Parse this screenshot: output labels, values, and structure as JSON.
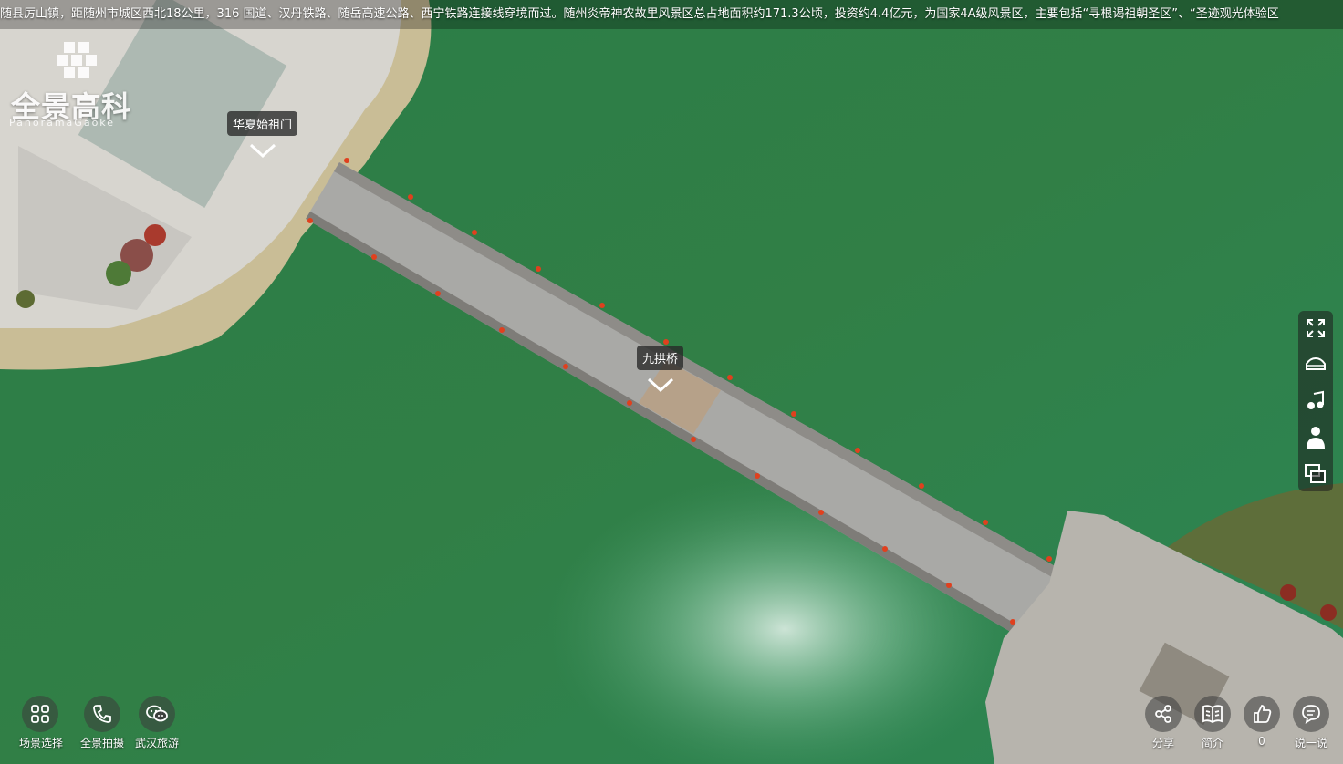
{
  "marquee": {
    "text": "随县厉山镇，距随州市城区西北18公里，316 国道、汉丹铁路、随岳高速公路、西宁铁路连接线穿境而过。随州炎帝神农故里风景区总占地面积约171.3公顷，投资约4.4亿元，为国家4A级风景区，主要包括“寻根谒祖朝圣区”、“圣迹观光体验区"
  },
  "logo": {
    "title": "全景高科",
    "subtitle": "PanoramaGaoke"
  },
  "hotspots": [
    {
      "label": "华夏始祖门"
    },
    {
      "label": "九拱桥"
    }
  ],
  "toolbar": {
    "items": [
      "fullscreen-icon",
      "vr-glasses-icon",
      "music-icon",
      "gyroscope-person-icon",
      "window-icon"
    ]
  },
  "bottom_left": [
    {
      "label": "场景选择",
      "icon": "grid-icon"
    },
    {
      "label": "全景拍摄",
      "icon": "phone-icon"
    },
    {
      "label": "武汉旅游",
      "icon": "wechat-icon"
    }
  ],
  "bottom_right": [
    {
      "label": "分享",
      "icon": "share-icon"
    },
    {
      "label": "简介",
      "icon": "book-icon"
    },
    {
      "label": "0",
      "icon": "thumbs-up-icon"
    },
    {
      "label": "说一说",
      "icon": "comment-icon"
    }
  ]
}
